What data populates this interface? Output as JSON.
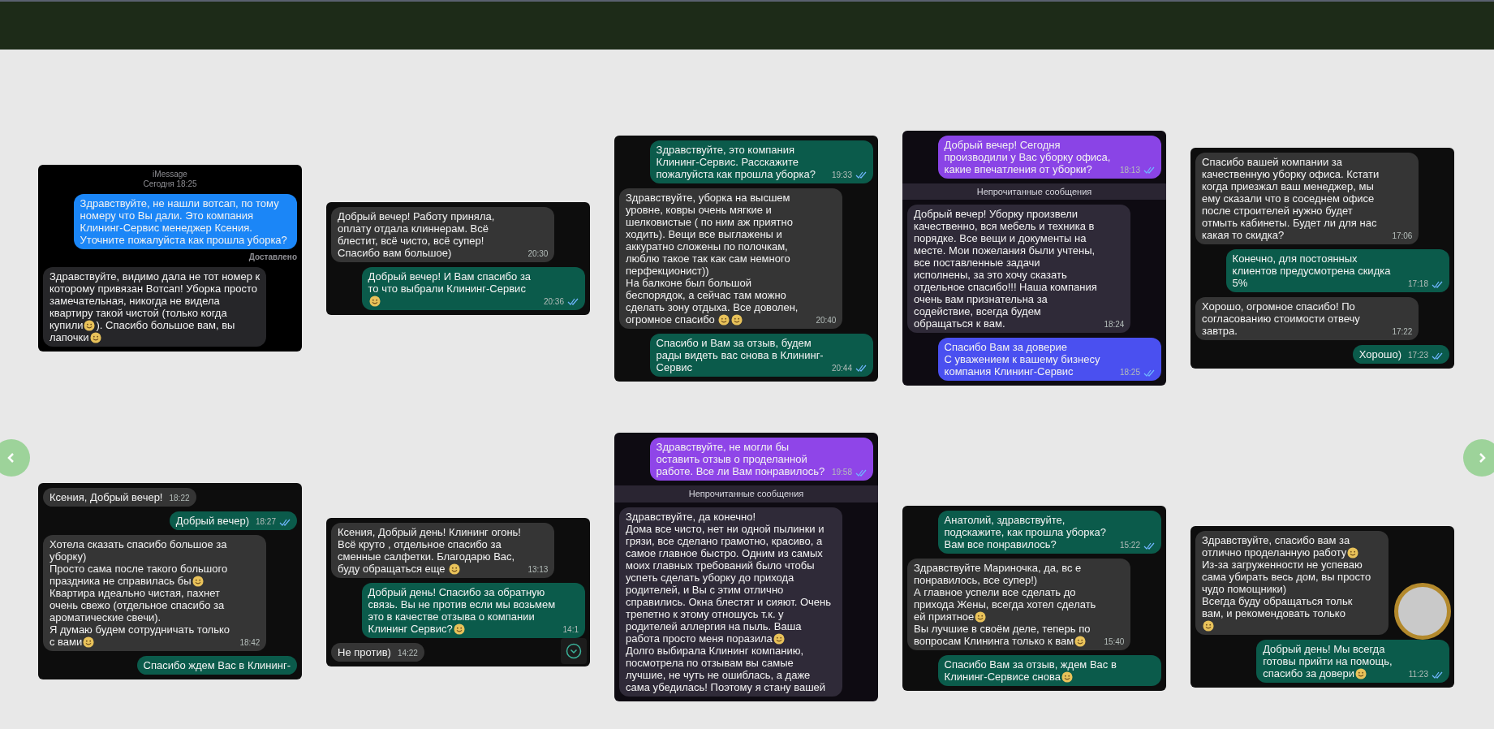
{
  "rows": [
    {
      "cards": [
        {
          "kind": "imessage",
          "items": [
            {
              "kind": "header",
              "lines": [
                "iMessage",
                "Сегодня 18:25"
              ]
            },
            {
              "kind": "message",
              "outgoing": true,
              "color": "#1b86f7",
              "parts": [
                {
                  "kind": "text",
                  "text": "Здравствуйте, не нашли вотсап, по тому номеру что Вы дали. Это компания Клининг-Сервис менеджер Ксения. Уточните пожалуйста как прошла уборка?"
                }
              ],
              "ticks": false
            },
            {
              "kind": "status",
              "text": "Доставлено"
            },
            {
              "kind": "message",
              "outgoing": false,
              "color": "#262629",
              "parts": [
                {
                  "kind": "text",
                  "text": "Здравствуйте, видимо дала не тот номер к которому привязан Вотсап! Уборка просто замечательная, никогда не видела квартиру такой чистой (только когда купили"
                },
                {
                  "kind": "emoji"
                },
                {
                  "kind": "text",
                  "text": "). Спасибо большое вам, вы лапочки"
                },
                {
                  "kind": "emoji"
                }
              ],
              "ticks": false
            }
          ]
        },
        {
          "kind": "whatsapp",
          "items": [
            {
              "kind": "message",
              "outgoing": false,
              "color": "#353535",
              "parts": [
                {
                  "kind": "text",
                  "text": "Добрый вечер! Работу приняла, оплату отдала клиннерам. Всё блестит, всё чисто, всё супер! Спасибо вам большое)"
                }
              ],
              "time": "20:30",
              "ticks": false
            },
            {
              "kind": "message",
              "outgoing": true,
              "color": "#0b5b4b",
              "parts": [
                {
                  "kind": "text",
                  "text": "Добрый вечер! И Вам спасибо за то что выбрали Клининг-Сервис "
                },
                {
                  "kind": "emoji"
                }
              ],
              "time": "20:36",
              "ticks": true
            }
          ]
        },
        {
          "kind": "whatsapp",
          "items": [
            {
              "kind": "message",
              "outgoing": true,
              "color": "#0b5b4b",
              "parts": [
                {
                  "kind": "text",
                  "text": "Здравствуйте, это компания Клининг-Сервис. Расскажите пожалуйста как прошла уборка?"
                }
              ],
              "time": "19:33",
              "ticks": true
            },
            {
              "kind": "message",
              "outgoing": false,
              "color": "#353535",
              "parts": [
                {
                  "kind": "text",
                  "text": "Здравствуйте, уборка на высшем уровне, ковры очень мягкие и шелковистые ( по ним аж приятно ходить). Вещи все выглажены и аккуратно сложены по полочкам, люблю такое так как сам немного перфекционист))\nНа балконе был большой беспорядок, а сейчас там можно сделать зону отдыха. Все доволен, огромное спасибо "
                },
                {
                  "kind": "emoji"
                },
                {
                  "kind": "emoji"
                }
              ],
              "time": "20:40",
              "ticks": false
            },
            {
              "kind": "message",
              "outgoing": true,
              "color": "#0b5b4b",
              "parts": [
                {
                  "kind": "text",
                  "text": "Спасибо и Вам за отзыв, будем рады видеть вас снова в Клининг-Сервис"
                }
              ],
              "time": "20:44",
              "ticks": true
            }
          ]
        },
        {
          "kind": "telegram",
          "items": [
            {
              "kind": "message",
              "outgoing": true,
              "color": "#8a44e6",
              "parts": [
                {
                  "kind": "text",
                  "text": "Добрый вечер! Сегодня производили у Вас уборку офиса, какие впечатления от уборки?"
                }
              ],
              "time": "18:13",
              "ticks": true
            },
            {
              "kind": "divider",
              "text": "Непрочитанные сообщения"
            },
            {
              "kind": "message",
              "outgoing": false,
              "color": "#2f2a38",
              "parts": [
                {
                  "kind": "text",
                  "text": "Добрый вечер! Уборку произвели качественно, вся мебель и техника в порядке. Все вещи и документы на месте. Мои пожелания были учтены, все поставленные задачи исполнены, за это хочу сказать отдельное спасибо!!! Наша компания очень вам признательна за содействие, всегда будем обращаться к вам."
                }
              ],
              "time": "18:24",
              "ticks": false
            },
            {
              "kind": "message",
              "outgoing": true,
              "color": "#4a50f0",
              "parts": [
                {
                  "kind": "text",
                  "text": "Спасибо Вам за доверие\nС уважением к вашему бизнесу компания Клининг-Сервис"
                }
              ],
              "time": "18:25",
              "ticks": true
            }
          ]
        },
        {
          "kind": "whatsapp",
          "items": [
            {
              "kind": "message",
              "outgoing": false,
              "color": "#353535",
              "parts": [
                {
                  "kind": "text",
                  "text": "Спасибо вашей компании за качественную уборку офиса. Кстати когда приезжал ваш менеджер, мы ему сказали что  в соседнем офисе после строителей нужно будет отмыть кабинеты. Будет ли для нас какая то скидка?"
                }
              ],
              "time": "17:06",
              "ticks": false
            },
            {
              "kind": "message",
              "outgoing": true,
              "color": "#0b5b4b",
              "parts": [
                {
                  "kind": "text",
                  "text": "Конечно, для постоянных клиентов предусмотрена скидка 5%"
                }
              ],
              "time": "17:18",
              "ticks": true
            },
            {
              "kind": "message",
              "outgoing": false,
              "color": "#353535",
              "parts": [
                {
                  "kind": "text",
                  "text": "Хорошо, огромное спасибо! По согласованию стоимости отвечу завтра."
                }
              ],
              "time": "17:22",
              "ticks": false
            },
            {
              "kind": "message",
              "outgoing": true,
              "color": "#0b5b4b",
              "parts": [
                {
                  "kind": "text",
                  "text": "Хорошо)"
                }
              ],
              "time": "17:23",
              "ticks": true
            }
          ]
        }
      ]
    },
    {
      "cards": [
        {
          "kind": "whatsapp",
          "items": [
            {
              "kind": "message",
              "outgoing": false,
              "color": "#353535",
              "parts": [
                {
                  "kind": "text",
                  "text": "Ксения, Добрый вечер!"
                }
              ],
              "time": "18:22",
              "ticks": false
            },
            {
              "kind": "message",
              "outgoing": true,
              "color": "#0b5b4b",
              "parts": [
                {
                  "kind": "text",
                  "text": "Добрый вечер)"
                }
              ],
              "time": "18:27",
              "ticks": true
            },
            {
              "kind": "message",
              "outgoing": false,
              "color": "#353535",
              "parts": [
                {
                  "kind": "text",
                  "text": "Хотела сказать спасибо большое за уборку)\nПросто сама после такого большого праздника не справилась бы"
                },
                {
                  "kind": "emoji"
                },
                {
                  "kind": "text",
                  "text": "\nКвартира идеально чистая, пахнет очень свежо (отдельное спасибо за ароматические свечи).\nЯ думаю будем сотрудничать только с вами"
                },
                {
                  "kind": "emoji"
                }
              ],
              "time": "18:42",
              "ticks": false
            },
            {
              "kind": "message",
              "outgoing": true,
              "color": "#0b5b4b",
              "parts": [
                {
                  "kind": "text",
                  "text": "Спасибо ждем Вас в Клининг-"
                }
              ],
              "ticks": false
            }
          ]
        },
        {
          "kind": "whatsapp",
          "scroll_button": true,
          "avatar": false,
          "items": [
            {
              "kind": "message",
              "outgoing": false,
              "color": "#353535",
              "parts": [
                {
                  "kind": "text",
                  "text": "Ксения, Добрый день! Клининг огонь! Всё круто ,  отдельное спасибо за сменные салфетки. Благодарю Вас, буду обращаться еще "
                },
                {
                  "kind": "emoji"
                }
              ],
              "time": "13:13",
              "ticks": false
            },
            {
              "kind": "message",
              "outgoing": true,
              "color": "#0b5b4b",
              "parts": [
                {
                  "kind": "text",
                  "text": "Добрый день! Спасибо за обратную связь. Вы не против если мы возьмем это в качестве отзыва о компании Клининг Сервис?"
                },
                {
                  "kind": "emoji"
                }
              ],
              "time": "14:1",
              "ticks": false
            },
            {
              "kind": "message",
              "outgoing": false,
              "color": "#353535",
              "parts": [
                {
                  "kind": "text",
                  "text": "Не против)"
                }
              ],
              "time": "14:22",
              "ticks": false
            }
          ]
        },
        {
          "kind": "telegram",
          "items": [
            {
              "kind": "message",
              "outgoing": true,
              "color": "#8f45e8",
              "parts": [
                {
                  "kind": "text",
                  "text": "Здравствуйте, не могли бы оставить отзыв о проделанной работе. Все ли Вам понравилось?"
                }
              ],
              "time": "19:58",
              "ticks": true
            },
            {
              "kind": "divider",
              "text": "Непрочитанные сообщения"
            },
            {
              "kind": "message",
              "outgoing": false,
              "color": "#2f2a38",
              "parts": [
                {
                  "kind": "text",
                  "text": "Здравствуйте, да конечно!\nДома все чисто, нет ни одной пылинки и грязи, все сделано грамотно, красиво, а самое главное быстро. Одним из самых моих главных требований было чтобы успеть сделать уборку до прихода родителей, и Вы с этим отлично справились. Окна блестят и сияют. Очень трепетно к этому отношусь т.к. у родителей аллергия на пыль. Ваша работа просто меня поразила"
                },
                {
                  "kind": "emoji"
                },
                {
                  "kind": "text",
                  "text": "\nДолго выбирала Клининг компанию, посмотрела по отзывам вы самые лучшие, не чуть не ошиблась, а даже сама убедилась! Поэтому я стану вашей"
                }
              ],
              "ticks": false
            }
          ]
        },
        {
          "kind": "whatsapp",
          "items": [
            {
              "kind": "message",
              "outgoing": true,
              "color": "#0b5b4b",
              "parts": [
                {
                  "kind": "text",
                  "text": "Анатолий, здравствуйте, подскажите, как прошла уборка? Вам все понравилось?"
                }
              ],
              "time": "15:22",
              "ticks": true
            },
            {
              "kind": "message",
              "outgoing": false,
              "color": "#353535",
              "parts": [
                {
                  "kind": "text",
                  "text": "Здравствуйте Мариночка, да, вс е понравилось, все супер!)\nА главное успели все сделать до прихода Жены, всегда хотел сделать ей приятное"
                },
                {
                  "kind": "emoji"
                },
                {
                  "kind": "text",
                  "text": "\nВы лучшие в своём деле, теперь по вопросам Клининга только к вам"
                },
                {
                  "kind": "emoji"
                }
              ],
              "time": "15:40",
              "ticks": false
            },
            {
              "kind": "message",
              "outgoing": true,
              "color": "#0b5b4b",
              "parts": [
                {
                  "kind": "text",
                  "text": "Спасибо Вам за отзыв, ждем Вас в Клининг-Сервисе снова"
                },
                {
                  "kind": "emoji"
                }
              ],
              "ticks": false
            }
          ]
        },
        {
          "kind": "whatsapp",
          "scroll_button": false,
          "avatar": true,
          "items": [
            {
              "kind": "message",
              "outgoing": false,
              "color": "#353535",
              "parts": [
                {
                  "kind": "text",
                  "text": "Здравствуйте, спасибо вам за отлично проделанную работу"
                },
                {
                  "kind": "emoji"
                },
                {
                  "kind": "text",
                  "text": "\nИз-за загруженности не успеваю сама убирать весь дом, вы просто чудо помощники)\nВсегда буду обращаться тольк\nвам, и рекомендовать только\n"
                },
                {
                  "kind": "emoji"
                }
              ],
              "ticks": false
            },
            {
              "kind": "message",
              "outgoing": true,
              "color": "#0b5b4b",
              "parts": [
                {
                  "kind": "text",
                  "text": "Добрый день! Мы всегда готовы прийти на помощь, спасибо за довери"
                },
                {
                  "kind": "emoji"
                }
              ],
              "time": "11:23",
              "ticks": true
            }
          ]
        }
      ]
    }
  ]
}
